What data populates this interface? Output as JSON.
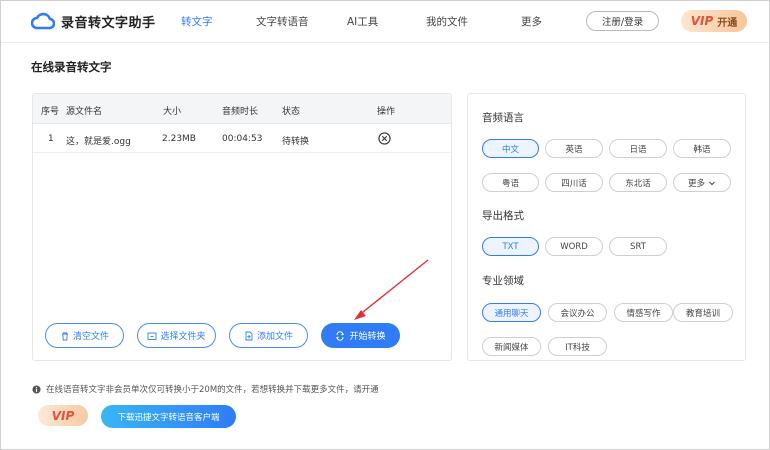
{
  "header": {
    "app_title": "录音转文字助手",
    "nav": [
      "转文字",
      "文字转语音",
      "AI工具",
      "我的文件",
      "更多"
    ],
    "login": "注册/登录",
    "vip_logo": "VIP",
    "vip_label": "开通"
  },
  "page_title": "在线录音转文字",
  "file_table": {
    "headers": [
      "序号",
      "源文件名",
      "大小",
      "音频时长",
      "状态",
      "操作"
    ],
    "rows": [
      {
        "index": "1",
        "name": "这，就是爱.ogg",
        "size": "2.23MB",
        "duration": "00:04:53",
        "status": "待转换"
      }
    ]
  },
  "actions": {
    "clear": "清空文件",
    "choose_folder": "选择文件夹",
    "add_file": "添加文件",
    "start": "开始转换"
  },
  "options": {
    "language_label": "音频语言",
    "languages": [
      "中文",
      "英语",
      "日语",
      "韩语",
      "粤语",
      "四川话",
      "东北话",
      "更多"
    ],
    "selected_language": "中文",
    "format_label": "导出格式",
    "formats": [
      "TXT",
      "WORD",
      "SRT"
    ],
    "selected_format": "TXT",
    "domain_label": "专业领域",
    "domains": [
      "通用聊天",
      "会议办公",
      "情感写作",
      "教育培训",
      "新闻媒体",
      "IT科技"
    ],
    "selected_domain": "通用聊天"
  },
  "notice": "在线语音转文字非会员单次仅可转换小于20M的文件，若想转换并下载更多文件，请开通",
  "footer": {
    "vip_badge": "VIP",
    "download": "下载迅捷文字转语音客户端"
  },
  "colors": {
    "accent": "#2f7cf6",
    "annotation_arrow": "#e03232"
  }
}
